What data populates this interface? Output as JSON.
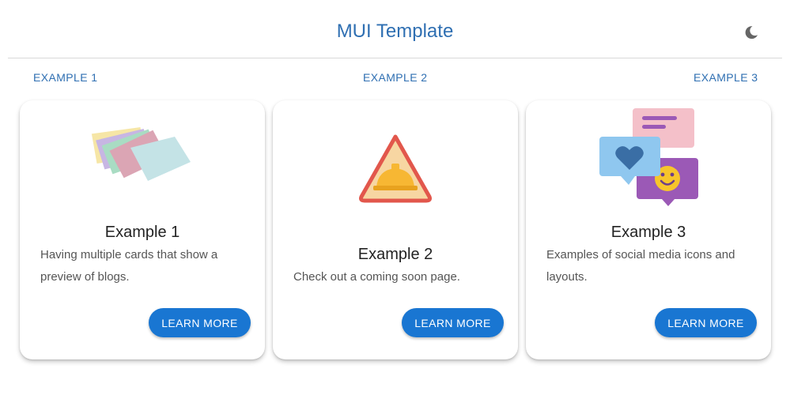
{
  "header": {
    "title": "MUI Template",
    "theme_toggle_icon": "moon-icon"
  },
  "nav": {
    "links": [
      "EXAMPLE 1",
      "EXAMPLE 2",
      "EXAMPLE 3"
    ]
  },
  "cards": [
    {
      "title": "Example 1",
      "description": "Having multiple cards that show a preview of blogs.",
      "button": "LEARN MORE",
      "image_icon": "stacked-cards-illustration"
    },
    {
      "title": "Example 2",
      "description": "Check out a coming soon page.",
      "button": "LEARN MORE",
      "image_icon": "construction-warning-icon"
    },
    {
      "title": "Example 3",
      "description": "Examples of social media icons and layouts.",
      "button": "LEARN MORE",
      "image_icon": "chat-bubbles-illustration"
    }
  ],
  "colors": {
    "primary": "#1976d2",
    "title": "#2f6fb2"
  }
}
